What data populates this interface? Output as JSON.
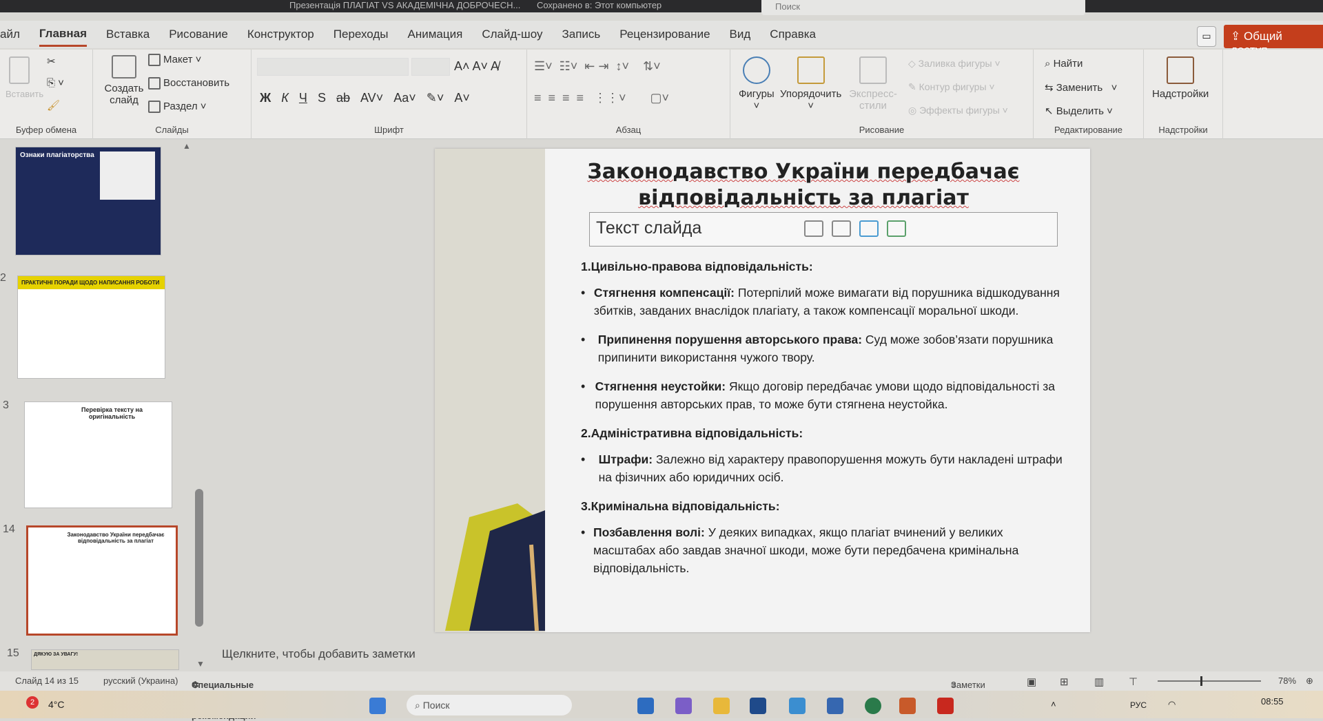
{
  "titlebar": {
    "file": "Презентація ПЛАГІАТ VS АКАДЕМІЧНА ДОБРОЧЕСН...",
    "saved": "Сохранено в: Этот компьютер",
    "search": "Поиск"
  },
  "tabs": [
    "айл",
    "Главная",
    "Вставка",
    "Рисование",
    "Конструктор",
    "Переходы",
    "Анимация",
    "Слайд-шоу",
    "Запись",
    "Рецензирование",
    "Вид",
    "Справка"
  ],
  "share": "Общий доступ",
  "ribbon": {
    "clipboard": {
      "paste": "Вставить",
      "label": "Буфер обмена"
    },
    "slides": {
      "new_slide": "Создать слайд",
      "layout": "Макет",
      "reset": "Восстановить",
      "section": "Раздел",
      "label": "Слайды"
    },
    "font": {
      "bold": "Ж",
      "italic": "К",
      "underline": "Ч",
      "shadow": "S",
      "strike": "ab",
      "spacing": "AV",
      "case": "Aa",
      "label": "Шрифт"
    },
    "paragraph": {
      "label": "Абзац"
    },
    "drawing": {
      "shapes": "Фигуры",
      "arrange": "Упорядочить",
      "quick_styles": "Экспресс-стили",
      "fill": "Заливка фигуры",
      "outline": "Контур фигуры",
      "effects": "Эффекты фигуры",
      "label": "Рисование"
    },
    "editing": {
      "find": "Найти",
      "replace": "Заменить",
      "select": "Выделить",
      "label": "Редактирование"
    },
    "addins": {
      "addins": "Надстройки",
      "label": "Надстройки"
    }
  },
  "thumbnails": [
    {
      "num": "",
      "title": "Ознаки плагіаторства"
    },
    {
      "num": "2",
      "title": "ПРАКТИЧНІ ПОРАДИ ЩОДО НАПИСАННЯ РОБОТИ"
    },
    {
      "num": "3",
      "title": "Перевірка тексту на оригінальність"
    },
    {
      "num": "14",
      "title": "Законодавство України передбачає відповідальність за плагіат"
    },
    {
      "num": "15",
      "title": "ДЯКУЮ ЗА УВАГУ!"
    }
  ],
  "slide": {
    "title": "Законодавство України передбачає відповідальність за плагіат",
    "textbox_placeholder": "Текст слайда",
    "sections": [
      {
        "heading": "1.Цивільно-правова відповідальність:",
        "bullets": [
          {
            "term": "Стягнення компенсації:",
            "text": " Потерпілий може вимагати від порушника відшкодування збитків, завданих внаслідок плагіату, а також компенсації моральної шкоди."
          },
          {
            "term": "Припинення порушення авторського права:",
            "text": " Суд може зобов’язати порушника припинити використання чужого твору."
          },
          {
            "term": "Стягнення неустойки:",
            "text": " Якщо договір передбачає умови щодо відповідальності за порушення авторських прав, то може бути стягнена неустойка."
          }
        ]
      },
      {
        "heading": "2.Адміністративна відповідальність:",
        "bullets": [
          {
            "term": "Штрафи:",
            "text": " Залежно від характеру правопорушення можуть бути накладені штрафи на фізичних або юридичних осіб."
          }
        ]
      },
      {
        "heading": "3.Кримінальна відповідальність:",
        "bullets": [
          {
            "term": "Позбавлення волі:",
            "text": " У деяких випадках, якщо плагіат вчинений у великих масштабах або завдав значної шкоди, може бути передбачена кримінальна відповідальність."
          }
        ]
      }
    ]
  },
  "notes_placeholder": "Щелкните, чтобы добавить заметки",
  "status": {
    "slide": "Слайд 14 из 15",
    "language": "русский (Украина)",
    "accessibility": "Специальные возможности: проверьте рекомендации",
    "notes": "Заметки",
    "zoom": "78%"
  },
  "taskbar": {
    "weather": "4°C",
    "weather_badge": "2",
    "search": "Поиск",
    "lang": "РУС",
    "time": "08:55"
  },
  "colors": {
    "accent": "#c43e1c",
    "selected_thumb": "#b7472a"
  }
}
